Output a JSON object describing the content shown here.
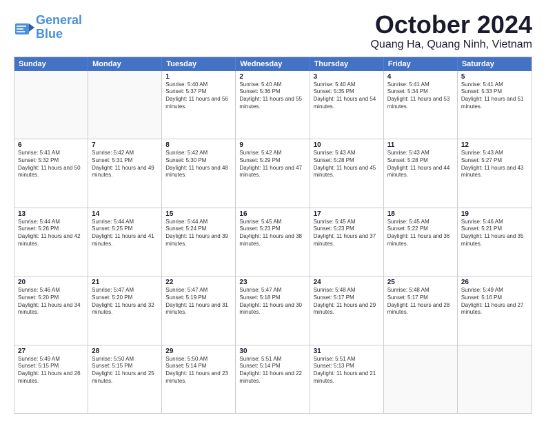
{
  "logo": {
    "line1": "General",
    "line2": "Blue"
  },
  "title": "October 2024",
  "subtitle": "Quang Ha, Quang Ninh, Vietnam",
  "header_days": [
    "Sunday",
    "Monday",
    "Tuesday",
    "Wednesday",
    "Thursday",
    "Friday",
    "Saturday"
  ],
  "weeks": [
    [
      {
        "day": "",
        "sunrise": "",
        "sunset": "",
        "daylight": ""
      },
      {
        "day": "",
        "sunrise": "",
        "sunset": "",
        "daylight": ""
      },
      {
        "day": "1",
        "sunrise": "Sunrise: 5:40 AM",
        "sunset": "Sunset: 5:37 PM",
        "daylight": "Daylight: 11 hours and 56 minutes."
      },
      {
        "day": "2",
        "sunrise": "Sunrise: 5:40 AM",
        "sunset": "Sunset: 5:36 PM",
        "daylight": "Daylight: 11 hours and 55 minutes."
      },
      {
        "day": "3",
        "sunrise": "Sunrise: 5:40 AM",
        "sunset": "Sunset: 5:35 PM",
        "daylight": "Daylight: 11 hours and 54 minutes."
      },
      {
        "day": "4",
        "sunrise": "Sunrise: 5:41 AM",
        "sunset": "Sunset: 5:34 PM",
        "daylight": "Daylight: 11 hours and 53 minutes."
      },
      {
        "day": "5",
        "sunrise": "Sunrise: 5:41 AM",
        "sunset": "Sunset: 5:33 PM",
        "daylight": "Daylight: 11 hours and 51 minutes."
      }
    ],
    [
      {
        "day": "6",
        "sunrise": "Sunrise: 5:41 AM",
        "sunset": "Sunset: 5:32 PM",
        "daylight": "Daylight: 11 hours and 50 minutes."
      },
      {
        "day": "7",
        "sunrise": "Sunrise: 5:42 AM",
        "sunset": "Sunset: 5:31 PM",
        "daylight": "Daylight: 11 hours and 49 minutes."
      },
      {
        "day": "8",
        "sunrise": "Sunrise: 5:42 AM",
        "sunset": "Sunset: 5:30 PM",
        "daylight": "Daylight: 11 hours and 48 minutes."
      },
      {
        "day": "9",
        "sunrise": "Sunrise: 5:42 AM",
        "sunset": "Sunset: 5:29 PM",
        "daylight": "Daylight: 11 hours and 47 minutes."
      },
      {
        "day": "10",
        "sunrise": "Sunrise: 5:43 AM",
        "sunset": "Sunset: 5:28 PM",
        "daylight": "Daylight: 11 hours and 45 minutes."
      },
      {
        "day": "11",
        "sunrise": "Sunrise: 5:43 AM",
        "sunset": "Sunset: 5:28 PM",
        "daylight": "Daylight: 11 hours and 44 minutes."
      },
      {
        "day": "12",
        "sunrise": "Sunrise: 5:43 AM",
        "sunset": "Sunset: 5:27 PM",
        "daylight": "Daylight: 11 hours and 43 minutes."
      }
    ],
    [
      {
        "day": "13",
        "sunrise": "Sunrise: 5:44 AM",
        "sunset": "Sunset: 5:26 PM",
        "daylight": "Daylight: 11 hours and 42 minutes."
      },
      {
        "day": "14",
        "sunrise": "Sunrise: 5:44 AM",
        "sunset": "Sunset: 5:25 PM",
        "daylight": "Daylight: 11 hours and 41 minutes."
      },
      {
        "day": "15",
        "sunrise": "Sunrise: 5:44 AM",
        "sunset": "Sunset: 5:24 PM",
        "daylight": "Daylight: 11 hours and 39 minutes."
      },
      {
        "day": "16",
        "sunrise": "Sunrise: 5:45 AM",
        "sunset": "Sunset: 5:23 PM",
        "daylight": "Daylight: 11 hours and 38 minutes."
      },
      {
        "day": "17",
        "sunrise": "Sunrise: 5:45 AM",
        "sunset": "Sunset: 5:23 PM",
        "daylight": "Daylight: 11 hours and 37 minutes."
      },
      {
        "day": "18",
        "sunrise": "Sunrise: 5:45 AM",
        "sunset": "Sunset: 5:22 PM",
        "daylight": "Daylight: 11 hours and 36 minutes."
      },
      {
        "day": "19",
        "sunrise": "Sunrise: 5:46 AM",
        "sunset": "Sunset: 5:21 PM",
        "daylight": "Daylight: 11 hours and 35 minutes."
      }
    ],
    [
      {
        "day": "20",
        "sunrise": "Sunrise: 5:46 AM",
        "sunset": "Sunset: 5:20 PM",
        "daylight": "Daylight: 11 hours and 34 minutes."
      },
      {
        "day": "21",
        "sunrise": "Sunrise: 5:47 AM",
        "sunset": "Sunset: 5:20 PM",
        "daylight": "Daylight: 11 hours and 32 minutes."
      },
      {
        "day": "22",
        "sunrise": "Sunrise: 5:47 AM",
        "sunset": "Sunset: 5:19 PM",
        "daylight": "Daylight: 11 hours and 31 minutes."
      },
      {
        "day": "23",
        "sunrise": "Sunrise: 5:47 AM",
        "sunset": "Sunset: 5:18 PM",
        "daylight": "Daylight: 11 hours and 30 minutes."
      },
      {
        "day": "24",
        "sunrise": "Sunrise: 5:48 AM",
        "sunset": "Sunset: 5:17 PM",
        "daylight": "Daylight: 11 hours and 29 minutes."
      },
      {
        "day": "25",
        "sunrise": "Sunrise: 5:48 AM",
        "sunset": "Sunset: 5:17 PM",
        "daylight": "Daylight: 11 hours and 28 minutes."
      },
      {
        "day": "26",
        "sunrise": "Sunrise: 5:49 AM",
        "sunset": "Sunset: 5:16 PM",
        "daylight": "Daylight: 11 hours and 27 minutes."
      }
    ],
    [
      {
        "day": "27",
        "sunrise": "Sunrise: 5:49 AM",
        "sunset": "Sunset: 5:15 PM",
        "daylight": "Daylight: 11 hours and 26 minutes."
      },
      {
        "day": "28",
        "sunrise": "Sunrise: 5:50 AM",
        "sunset": "Sunset: 5:15 PM",
        "daylight": "Daylight: 11 hours and 25 minutes."
      },
      {
        "day": "29",
        "sunrise": "Sunrise: 5:50 AM",
        "sunset": "Sunset: 5:14 PM",
        "daylight": "Daylight: 11 hours and 23 minutes."
      },
      {
        "day": "30",
        "sunrise": "Sunrise: 5:51 AM",
        "sunset": "Sunset: 5:14 PM",
        "daylight": "Daylight: 11 hours and 22 minutes."
      },
      {
        "day": "31",
        "sunrise": "Sunrise: 5:51 AM",
        "sunset": "Sunset: 5:13 PM",
        "daylight": "Daylight: 11 hours and 21 minutes."
      },
      {
        "day": "",
        "sunrise": "",
        "sunset": "",
        "daylight": ""
      },
      {
        "day": "",
        "sunrise": "",
        "sunset": "",
        "daylight": ""
      }
    ]
  ]
}
